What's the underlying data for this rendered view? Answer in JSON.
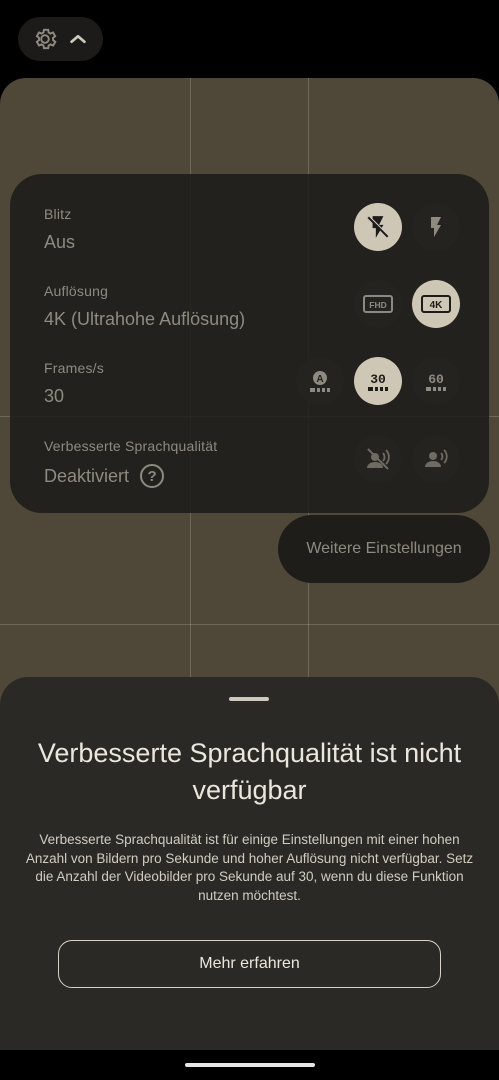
{
  "topbar": {
    "settings_icon": "gear-icon",
    "collapse_icon": "chevron-up-icon"
  },
  "settings": {
    "flash": {
      "label": "Blitz",
      "value": "Aus",
      "options": [
        {
          "icon": "flash-off-icon",
          "selected": true
        },
        {
          "icon": "flash-on-icon",
          "selected": false
        }
      ]
    },
    "resolution": {
      "label": "Auflösung",
      "value": "4K (Ultrahohe Auflösung)",
      "options": [
        {
          "icon": "fhd-icon",
          "text": "FHD",
          "selected": false
        },
        {
          "icon": "4k-icon",
          "text": "4K",
          "selected": true
        }
      ]
    },
    "fps": {
      "label": "Frames/s",
      "value": "30",
      "options": [
        {
          "icon": "auto-fps-icon",
          "text": "A",
          "selected": false
        },
        {
          "icon": "30-fps-icon",
          "text": "30",
          "selected": true
        },
        {
          "icon": "60-fps-icon",
          "text": "60",
          "selected": false
        }
      ]
    },
    "speech": {
      "label": "Verbesserte Sprachqualität",
      "value": "Deaktiviert",
      "help": "?",
      "options": [
        {
          "icon": "speech-off-icon",
          "selected": false
        },
        {
          "icon": "speech-on-icon",
          "selected": false
        }
      ]
    }
  },
  "more_settings": "Weitere Einstellungen",
  "sheet": {
    "title": "Verbesserte Sprachqualität ist nicht verfügbar",
    "body": "Verbesserte Sprachqualität ist für einige Einstellungen mit einer hohen Anzahl von Bildern pro Sekunde und hoher Auflösung nicht verfügbar. Setz die Anzahl der Videobilder pro Sekunde auf 30, wenn du diese Funktion nutzen möchtest.",
    "button": "Mehr erfahren"
  },
  "colors": {
    "selected_option": "#cfc7b6",
    "panel_bg": "#1e1c19",
    "sheet_bg": "#2b2926"
  }
}
